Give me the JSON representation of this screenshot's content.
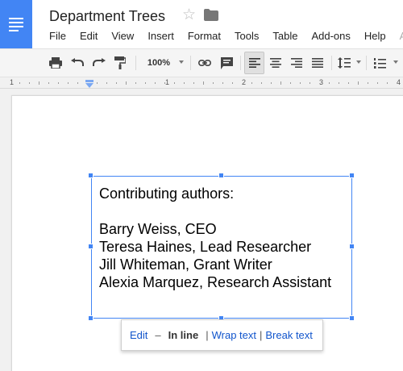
{
  "app": {
    "title": "Department Trees",
    "brand_color": "#4285f4"
  },
  "menu": {
    "items": [
      "File",
      "Edit",
      "View",
      "Insert",
      "Format",
      "Tools",
      "Table",
      "Add-ons",
      "Help"
    ],
    "trailing": "Al"
  },
  "toolbar": {
    "zoom": "100%",
    "icons": [
      "print-icon",
      "undo-icon",
      "redo-icon",
      "paint-format-icon",
      "link-icon",
      "comment-icon",
      "align-left-icon",
      "align-center-icon",
      "align-right-icon",
      "justify-icon",
      "line-spacing-icon",
      "numbered-list-icon"
    ],
    "active_alignment": "left"
  },
  "ruler": {
    "numbers": [
      "1",
      "1",
      "2",
      "3",
      "4"
    ]
  },
  "textbox": {
    "lines": [
      "Contributing authors:",
      "",
      "Barry Weiss, CEO",
      "Teresa Haines, Lead Researcher",
      "Jill Whiteman, Grant Writer",
      "Alexia Marquez, Research Assistant"
    ]
  },
  "wrap_popup": {
    "edit": "Edit",
    "separator": "–",
    "in_line": "In line",
    "wrap_text": "Wrap text",
    "break_text": "Break text",
    "pipe": "|"
  }
}
